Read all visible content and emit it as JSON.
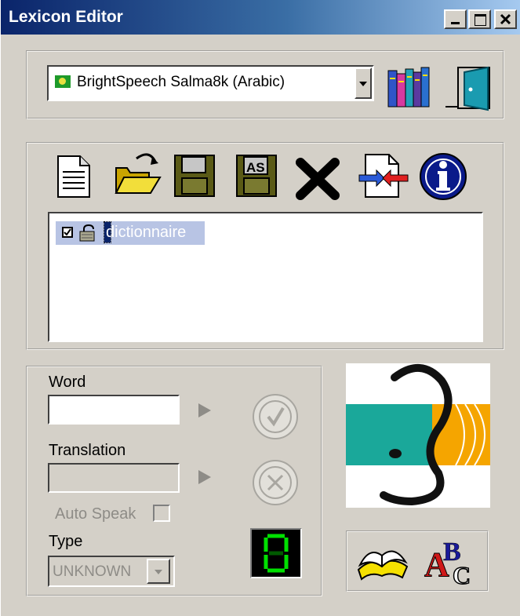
{
  "window": {
    "title": "Lexicon Editor"
  },
  "voice": {
    "selected": "BrightSpeech Salma8k (Arabic)"
  },
  "toolbar": {
    "icons": [
      "new-icon",
      "open-folder-icon",
      "save-icon",
      "save-as-icon",
      "delete-icon",
      "import-icon",
      "info-icon"
    ]
  },
  "lexicons": {
    "items": [
      {
        "label": "dictionnaire",
        "checked": true,
        "locked": true
      }
    ]
  },
  "form": {
    "word_label": "Word",
    "word_value": "",
    "translation_label": "Translation",
    "translation_value": "",
    "auto_speak_label": "Auto Speak",
    "auto_speak_checked": false,
    "type_label": "Type",
    "type_value": "UNKNOWN"
  },
  "colors": {
    "teal": "#1aa89a",
    "orange": "#f5a500",
    "title_blue": "#0a246a"
  }
}
